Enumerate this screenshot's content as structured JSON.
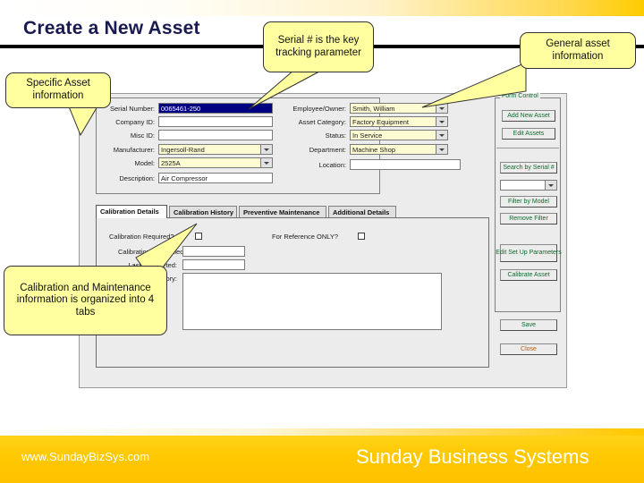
{
  "slide": {
    "title": "Create a New Asset",
    "footer_url": "www.SundayBizSys.com",
    "footer_brand": "Sunday Business Systems",
    "accent_gold": "#ffc800",
    "title_color": "#1a1a52",
    "callout_fill": "#ffffa0"
  },
  "callouts": [
    {
      "id": "specific-asset",
      "text": "Specific Asset information"
    },
    {
      "id": "serial-key",
      "text": "Serial # is the key tracking parameter"
    },
    {
      "id": "general-asset",
      "text": "General asset information"
    },
    {
      "id": "cal-maint",
      "text": "Calibration and Maintenance information is organized into 4 tabs"
    }
  ],
  "app": {
    "left_fields": [
      {
        "label": "Serial Number:",
        "value": "0065461-250",
        "type": "text",
        "selected": true
      },
      {
        "label": "Company ID:",
        "value": "",
        "type": "text",
        "selected": false
      },
      {
        "label": "Misc ID:",
        "value": "",
        "type": "text",
        "selected": false
      },
      {
        "label": "Manufacturer:",
        "value": "Ingersoll-Rand",
        "type": "combo"
      },
      {
        "label": "Model:",
        "value": "2525A",
        "type": "combo"
      },
      {
        "label": "Description:",
        "value": "Air Compressor",
        "type": "text",
        "selected": false
      }
    ],
    "right_fields": [
      {
        "label": "Employee/Owner:",
        "value": "Smith, William",
        "type": "combo"
      },
      {
        "label": "Asset Category:",
        "value": "Factory Equipment",
        "type": "combo"
      },
      {
        "label": "Status:",
        "value": "In Service",
        "type": "combo"
      },
      {
        "label": "Department:",
        "value": "Machine Shop",
        "type": "combo"
      },
      {
        "label": "Location:",
        "value": "",
        "type": "text",
        "selected": false
      }
    ],
    "tabs": [
      {
        "label": "Calibration Details",
        "active": true
      },
      {
        "label": "Calibration History",
        "active": false
      },
      {
        "label": "Preventive Maintenance",
        "active": false
      },
      {
        "label": "Additional Details",
        "active": false
      }
    ],
    "tab_content": {
      "cal_required_label": "Calibration Required?",
      "cal_required_checked": false,
      "reference_only_label": "For Reference ONLY?",
      "reference_only_checked": false,
      "scheduled_label": "Calibration Scheduled:",
      "scheduled_value": "",
      "completed_label": "Last Completed:",
      "completed_value": "",
      "notes_label": "Notes/Category:",
      "notes_value": ""
    },
    "panel": {
      "legend": "Form Control",
      "buttons": [
        {
          "id": "add-new-asset",
          "label": "Add New Asset"
        },
        {
          "id": "edit-assets",
          "label": "Edit Assets"
        },
        {
          "id": "search-serial",
          "label": "Search by Serial #"
        },
        {
          "id": "filter-model",
          "label": "Filter by Model"
        },
        {
          "id": "remove-filter",
          "label": "Remove Filter"
        },
        {
          "id": "edit-setup",
          "label": "Edit Set Up Parameters"
        },
        {
          "id": "calibrate-asset",
          "label": "Calibrate Asset"
        },
        {
          "id": "save",
          "label": "Save"
        },
        {
          "id": "close",
          "label": "Close"
        }
      ],
      "filter_combo_value": ""
    }
  }
}
